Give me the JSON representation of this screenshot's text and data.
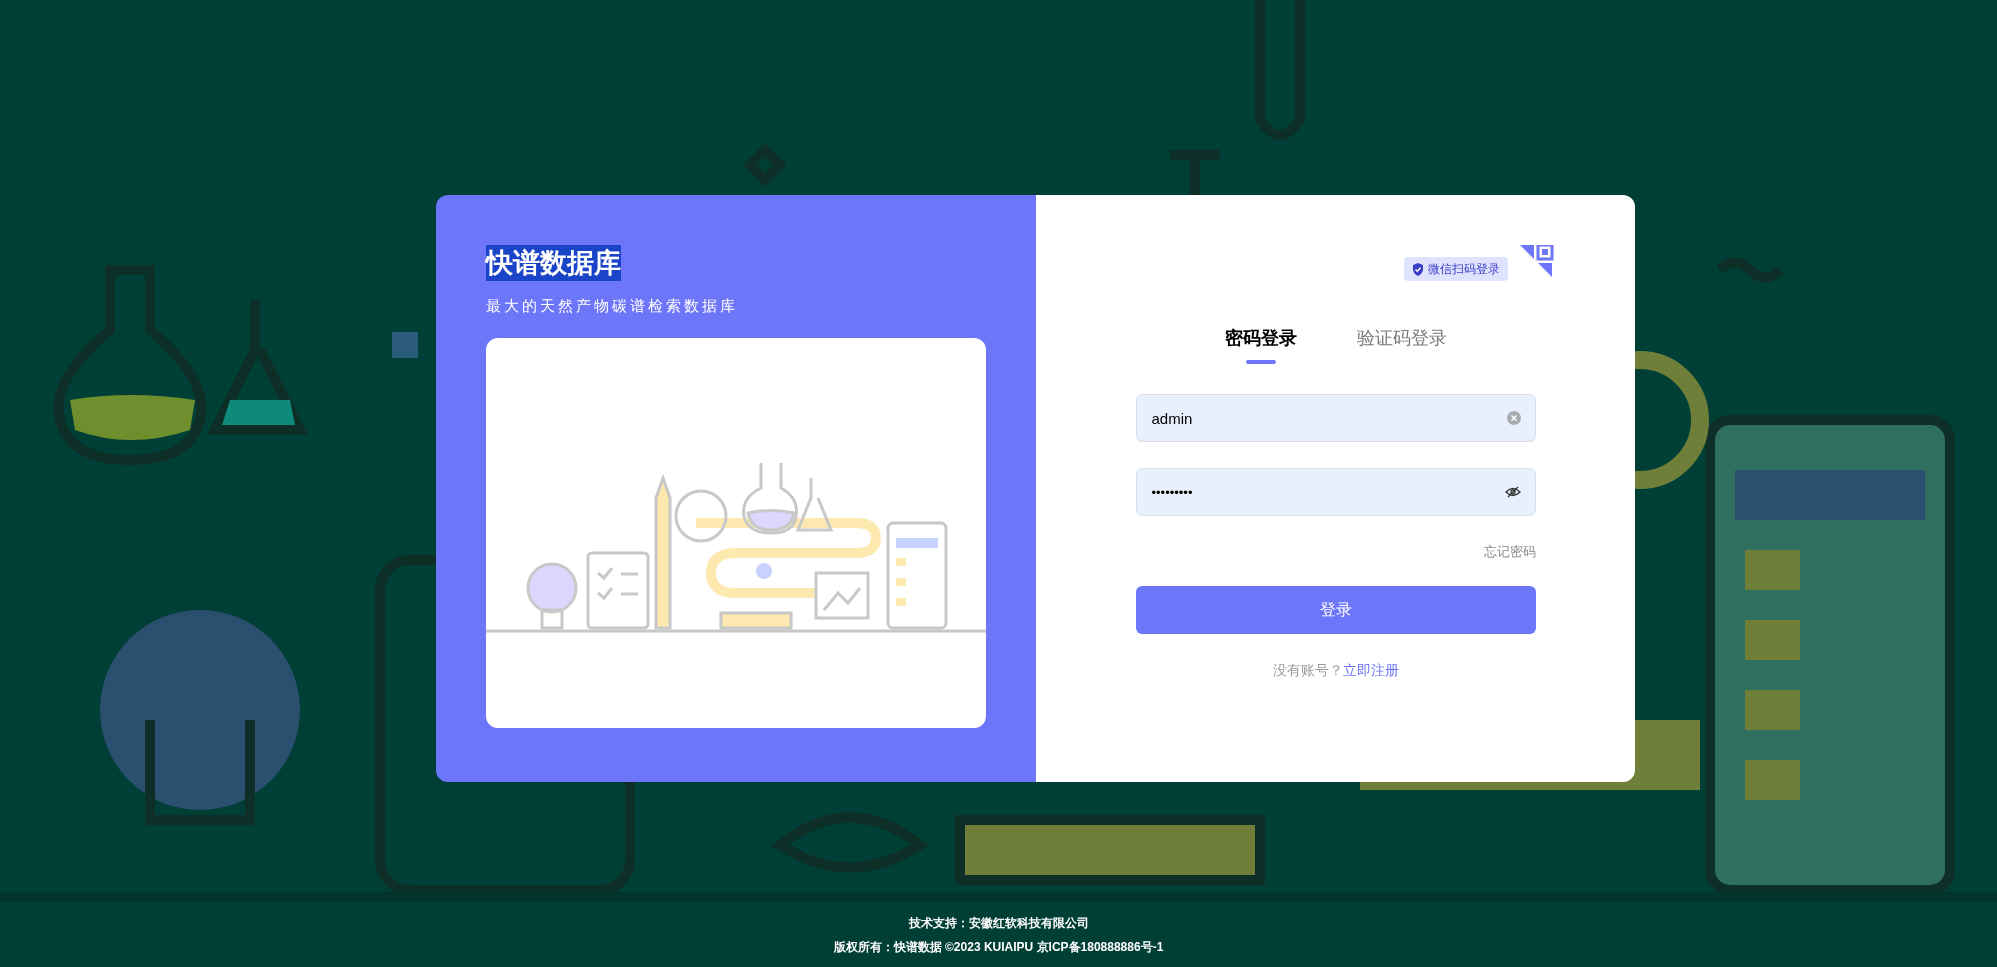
{
  "brand": {
    "title": "快谱数据库",
    "subtitle": "最大的天然产物碳谱检索数据库"
  },
  "wechat_login": {
    "label": "微信扫码登录"
  },
  "tabs": [
    {
      "label": "密码登录",
      "selected": true
    },
    {
      "label": "验证码登录",
      "selected": false
    }
  ],
  "username": {
    "value": "admin"
  },
  "password": {
    "value": "•••••••••"
  },
  "forgot_link": "忘记密码",
  "login_button": "登录",
  "register": {
    "prompt": "没有账号？",
    "link": "立即注册"
  },
  "footer": {
    "support": "技术支持：安徽红软科技有限公司",
    "copyright": "版权所有：快谱数据 ©2023 KUIAIPU 京ICP备180888886号-1"
  }
}
